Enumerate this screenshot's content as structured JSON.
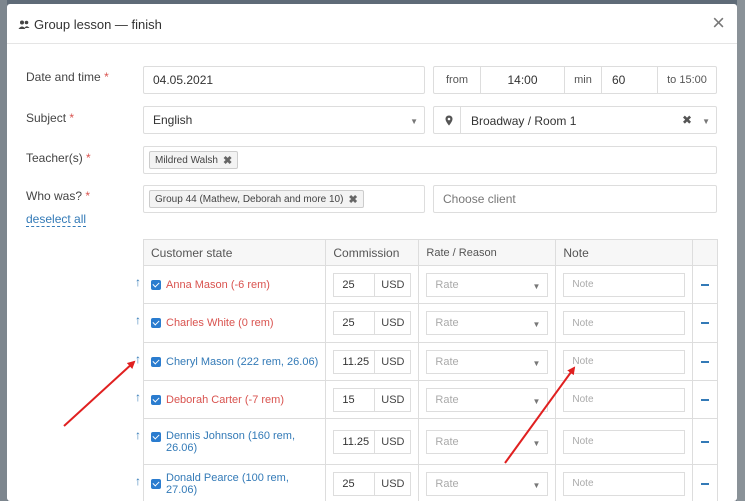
{
  "modal": {
    "title": "Group lesson — finish",
    "close": "×"
  },
  "form": {
    "date_label": "Date and time",
    "date_value": "04.05.2021",
    "from_label": "from",
    "time_value": "14:00",
    "min_label": "min",
    "min_value": "60",
    "to_label": "to 15:00",
    "subject_label": "Subject",
    "subject_value": "English",
    "location_value": "Broadway / Room 1",
    "teacher_label": "Teacher(s)",
    "teacher_value": "Mildred Walsh",
    "who_label": "Who was?",
    "group_value": "Group 44 (Mathew, Deborah and more 10)",
    "client_placeholder": "Choose client",
    "deselect": "deselect all",
    "required": "*"
  },
  "table": {
    "headers": [
      "Customer state",
      "Commission",
      "Rate / Reason",
      "Note"
    ],
    "rows": [
      {
        "name": "Anna Mason (-6 rem)",
        "color": "red",
        "commission": "25",
        "currency": "USD",
        "rate": "Rate",
        "note": "Note"
      },
      {
        "name": "Charles White (0 rem)",
        "color": "red",
        "commission": "25",
        "currency": "USD",
        "rate": "Rate",
        "note": "Note"
      },
      {
        "name": "Cheryl Mason (222 rem, 26.06)",
        "color": "blue",
        "commission": "11.25",
        "currency": "USD",
        "rate": "Rate",
        "note": "Note"
      },
      {
        "name": "Deborah Carter (-7 rem)",
        "color": "red",
        "commission": "15",
        "currency": "USD",
        "rate": "Rate",
        "note": "Note"
      },
      {
        "name": "Dennis Johnson (160 rem, 26.06)",
        "color": "blue",
        "commission": "11.25",
        "currency": "USD",
        "rate": "Rate",
        "note": "Note"
      },
      {
        "name": "Donald Pearce (100 rem, 27.06)",
        "color": "blue",
        "commission": "25",
        "currency": "USD",
        "rate": "Rate",
        "note": "Note"
      }
    ]
  },
  "colors": {
    "accent": "#337ab7",
    "red": "#d9534f",
    "arrow": "#e02020"
  }
}
